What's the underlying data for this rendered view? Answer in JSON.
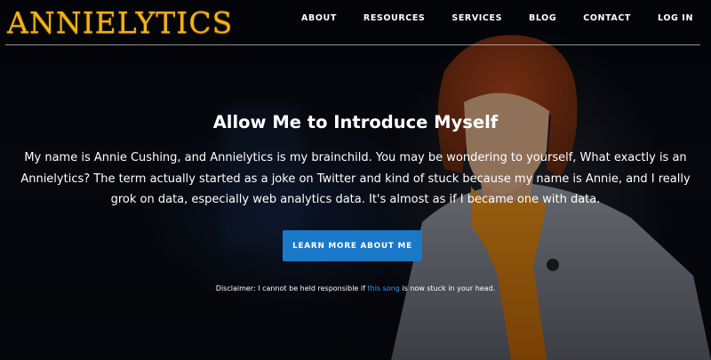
{
  "brand": {
    "logo_text": "ANNIELYTICS",
    "logo_color": "#f2b21c"
  },
  "nav": {
    "items": [
      {
        "label": "ABOUT"
      },
      {
        "label": "RESOURCES"
      },
      {
        "label": "SERVICES"
      },
      {
        "label": "BLOG"
      },
      {
        "label": "CONTACT"
      },
      {
        "label": "LOG IN"
      }
    ]
  },
  "hero": {
    "title": "Allow Me to Introduce Myself",
    "intro": "My name is Annie Cushing, and Annielytics is my brainchild. You may be wondering to yourself, What exactly is an Annielytics? The term actually started as a joke on Twitter and kind of stuck because my name is Annie, and I really grok on data, especially web analytics data. It's almost as if I became one with data.",
    "cta_label": "LEARN MORE ABOUT ME",
    "cta_color": "#1a78c8"
  },
  "disclaimer": {
    "before": "Disclaimer: I cannot be held responsible if ",
    "link": "this song",
    "after": " is now stuck in your head.",
    "link_color": "#3d9be9"
  }
}
